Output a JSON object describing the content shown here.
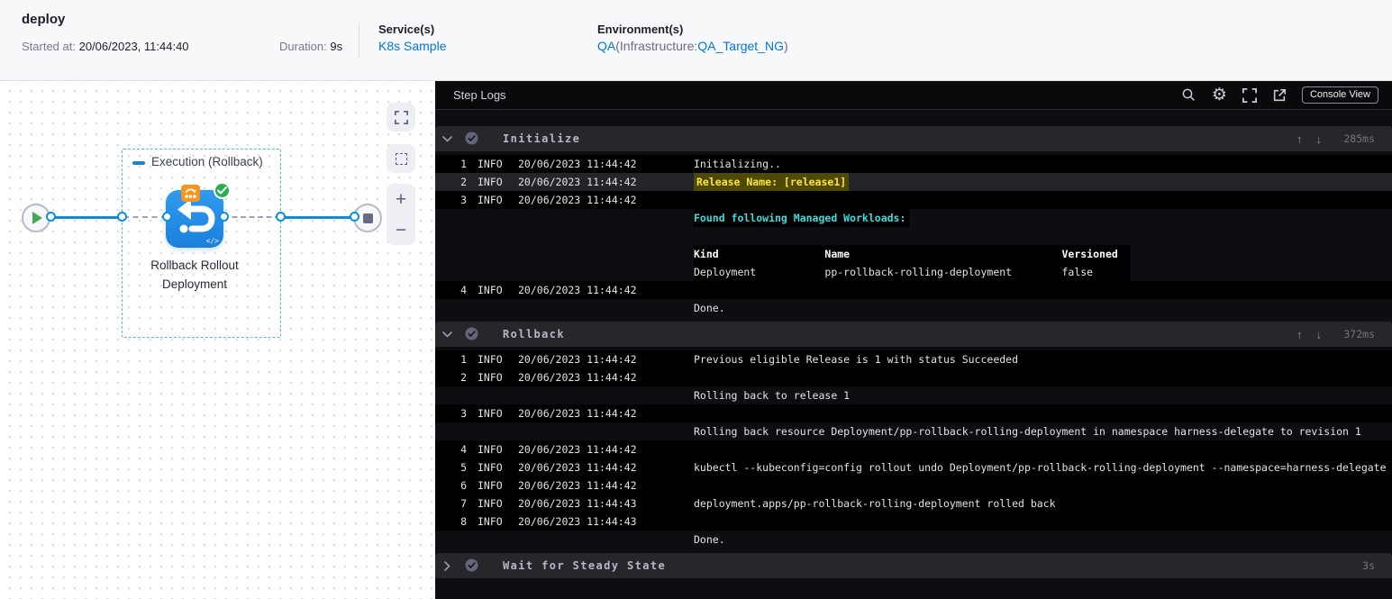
{
  "header": {
    "pipeline_name": "deploy",
    "started_label": "Started at:",
    "started_value": "20/06/2023, 11:44:40",
    "duration_label": "Duration:",
    "duration_value": "9s",
    "services_label": "Service(s)",
    "service_name": "K8s Sample",
    "environments_label": "Environment(s)",
    "environment_name": "QA",
    "infrastructure_prefix": "(Infrastructure:",
    "infrastructure_name": "QA_Target_NG",
    "infrastructure_suffix": ")"
  },
  "canvas": {
    "group_label": "Execution (Rollback)",
    "step_label_line1": "Rollback Rollout",
    "step_label_line2": "Deployment",
    "code_glyph": "</>",
    "zoom_in_glyph": "+",
    "zoom_out_glyph": "−",
    "colors": {
      "connector_blue": "#1486db",
      "step_blue": "#1f87e0",
      "badge_orange": "#f8941d",
      "success_green": "#27ae4f"
    }
  },
  "console": {
    "title": "Step Logs",
    "console_view_label": "Console View",
    "toolbar_icons": [
      "search-icon",
      "settings-gear-icon",
      "fullscreen-icon",
      "open-in-new-icon"
    ],
    "colors": {
      "highlight_yellow": "#ffe43c",
      "highlight_yellow_bg": "#4d4906",
      "info_cyan": "#3fdcdc"
    },
    "sections": [
      {
        "title": "Initialize",
        "duration": "285ms",
        "collapsed": false,
        "has_scroll_arrows": true,
        "rows": [
          {
            "num": "1",
            "level": "INFO",
            "time": "20/06/2023 11:44:42",
            "text": "Initializing..",
            "style": "plain",
            "row": "dark"
          },
          {
            "num": "2",
            "level": "INFO",
            "time": "20/06/2023 11:44:42",
            "text": "Release Name: [release1]",
            "style": "yellow",
            "row": "selected"
          },
          {
            "num": "3",
            "level": "INFO",
            "time": "20/06/2023 11:44:42",
            "text": "",
            "style": "plain",
            "row": "dark"
          },
          {
            "text": "Found following Managed Workloads:",
            "style": "cyan"
          },
          {
            "text": "",
            "style": "plain"
          },
          {
            "text": "Kind                 Name                                  Versioned  ",
            "style": "thead"
          },
          {
            "text": "Deployment           pp-rollback-rolling-deployment        false      ",
            "style": "trow"
          },
          {
            "num": "4",
            "level": "INFO",
            "time": "20/06/2023 11:44:42",
            "text": "",
            "style": "plain",
            "row": "dark"
          },
          {
            "text": "Done.",
            "style": "plain"
          }
        ]
      },
      {
        "title": "Rollback",
        "duration": "372ms",
        "collapsed": false,
        "has_scroll_arrows": true,
        "rows": [
          {
            "num": "1",
            "level": "INFO",
            "time": "20/06/2023 11:44:42",
            "text": "Previous eligible Release is 1 with status Succeeded",
            "style": "plain",
            "row": "dark"
          },
          {
            "num": "2",
            "level": "INFO",
            "time": "20/06/2023 11:44:42",
            "text": "",
            "style": "plain",
            "row": "dark"
          },
          {
            "text": "Rolling back to release 1",
            "style": "plain"
          },
          {
            "num": "3",
            "level": "INFO",
            "time": "20/06/2023 11:44:42",
            "text": "",
            "style": "plain",
            "row": "dark"
          },
          {
            "text": "Rolling back resource Deployment/pp-rollback-rolling-deployment in namespace harness-delegate to revision 1",
            "style": "plain"
          },
          {
            "num": "4",
            "level": "INFO",
            "time": "20/06/2023 11:44:42",
            "text": "",
            "style": "plain",
            "row": "dark"
          },
          {
            "num": "5",
            "level": "INFO",
            "time": "20/06/2023 11:44:42",
            "text": "kubectl --kubeconfig=config rollout undo Deployment/pp-rollback-rolling-deployment --namespace=harness-delegate",
            "style": "plain",
            "row": "dark"
          },
          {
            "num": "6",
            "level": "INFO",
            "time": "20/06/2023 11:44:42",
            "text": "",
            "style": "plain",
            "row": "dark"
          },
          {
            "num": "7",
            "level": "INFO",
            "time": "20/06/2023 11:44:43",
            "text": "deployment.apps/pp-rollback-rolling-deployment rolled back",
            "style": "plain",
            "row": "dark"
          },
          {
            "num": "8",
            "level": "INFO",
            "time": "20/06/2023 11:44:43",
            "text": "",
            "style": "plain",
            "row": "dark"
          },
          {
            "text": "Done.",
            "style": "plain"
          }
        ]
      },
      {
        "title": "Wait for Steady State",
        "duration": "3s",
        "collapsed": true,
        "has_scroll_arrows": false,
        "rows": []
      }
    ]
  }
}
